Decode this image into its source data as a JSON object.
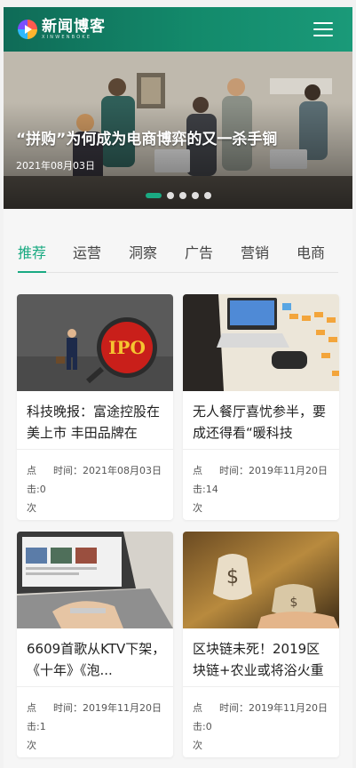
{
  "header": {
    "logo_cn": "新闻博客",
    "logo_en": "XINWENBOKE",
    "menu_icon": "hamburger-icon"
  },
  "banner": {
    "title": "“拼购”为何成为电商博弈的又一杀手锏",
    "date": "2021年08月03日",
    "slides": 5,
    "active_slide": 1
  },
  "tabs": [
    "推荐",
    "运营",
    "洞察",
    "广告",
    "营销",
    "电商"
  ],
  "active_tab": 0,
  "colors": {
    "brand": "#138a6b",
    "accent": "#1aaa82"
  },
  "cards": [
    {
      "title": "科技晚报：富途控股在美上市 丰田品牌在",
      "views_label": "点击:0次",
      "time": "时间：2021年08月03日"
    },
    {
      "title": "无人餐厅喜忧参半，要成还得看“暖科技",
      "views_label": "点击:14次",
      "time": "时间：2019年11月20日"
    },
    {
      "title": "6609首歌从KTV下架，《十年》《泡...",
      "views_label": "点击:1次",
      "time": "时间：2019年11月20日"
    },
    {
      "title": "区块链未死！2019区块链+农业或将浴火重",
      "views_label": "点击:0次",
      "time": "时间：2019年11月20日"
    }
  ]
}
